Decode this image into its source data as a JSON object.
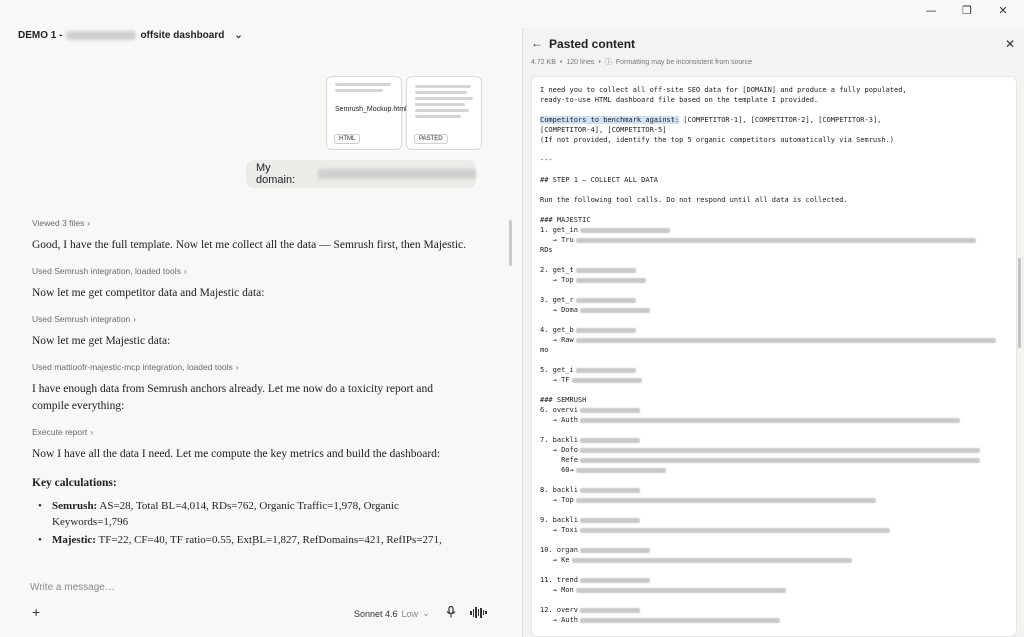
{
  "window": {
    "minimize": "—",
    "restore": "❐",
    "close": "✕"
  },
  "conversation": {
    "title_prefix": "DEMO 1 -",
    "title_suffix": "offsite dashboard",
    "attachments": [
      {
        "name": "Semrush_Mockup.html",
        "tag": "HTML"
      },
      {
        "name": "",
        "tag": "PASTED"
      }
    ],
    "user_message_prefix": "My domain:",
    "steps": [
      {
        "meta": "Viewed 3 files",
        "text": "Good, I have the full template. Now let me collect all the data — Semrush first, then Majestic."
      },
      {
        "meta": "Used Semrush integration, loaded tools",
        "text": "Now let me get competitor data and Majestic data:"
      },
      {
        "meta": "Used Semrush integration",
        "text": "Now let me get Majestic data:"
      },
      {
        "meta": "Used mattioofr-majestic-mcp integration, loaded tools",
        "text": "I have enough data from Semrush anchors already. Let me now do a toxicity report and compile everything:"
      },
      {
        "meta": "Execute report",
        "text": "Now I have all the data I need. Let me compute the key metrics and build the dashboard:"
      }
    ],
    "key_calc_heading": "Key calculations:",
    "calc_items": [
      {
        "label": "Semrush:",
        "text": "AS=28, Total BL=4,014, RDs=762, Organic Traffic=1,978, Organic Keywords=1,796"
      },
      {
        "label": "Majestic:",
        "text": "TF=22, CF=40, TF ratio=0.55, ExtBL=1,827, RefDomains=421, RefIPs=271,"
      }
    ]
  },
  "composer": {
    "placeholder": "Write a message…",
    "plus": "+",
    "model": "Sonnet 4.6",
    "effort": "Low"
  },
  "panel": {
    "title": "Pasted content",
    "size": "4.72 KB",
    "lines": "120 lines",
    "warning": "Formatting may be inconsistent from source",
    "doc_lines": [
      "I need you to collect all off-site SEO data for [DOMAIN] and produce a fully populated,",
      "ready-to-use HTML dashboard file based on the template I provided.",
      "",
      "Competitors to benchmark against: [COMPETITOR-1], [COMPETITOR-2], [COMPETITOR-3],",
      "[COMPETITOR-4], [COMPETITOR-5]",
      "(If not provided, identify the top 5 organic competitors automatically via Semrush.)",
      "",
      "---",
      "",
      "## STEP 1 — COLLECT ALL DATA",
      "",
      "Run the following tool calls. Do not respond until all data is collected.",
      "",
      "### MAJESTIC",
      "1. get_in",
      "   → Tru",
      "RDs",
      "",
      "2. get_t",
      "   → Top",
      "",
      "3. get_r",
      "   → Doma",
      "",
      "4. get_b",
      "   → Raw",
      "mo",
      "",
      "5. get_i",
      "   → TF",
      "",
      "### SEMRUSH",
      "6. overvi",
      "   → Auth",
      "",
      "7. backli",
      "   → Dofo",
      "     Refe",
      "     60→",
      "",
      "8. backli",
      "   → Top",
      "",
      "9. backli",
      "   → Toxi",
      "",
      "10. organ",
      "   → Ke",
      "",
      "11. trend",
      "   → Mon",
      "",
      "12. overv",
      "   → Auth"
    ]
  }
}
